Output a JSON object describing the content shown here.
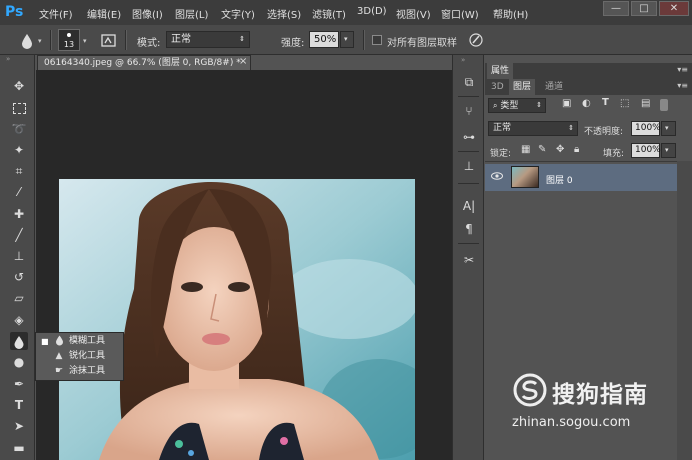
{
  "app": {
    "logo": "Ps"
  },
  "menubar": {
    "items": [
      "文件(F)",
      "编辑(E)",
      "图像(I)",
      "图层(L)",
      "文字(Y)",
      "选择(S)",
      "滤镜(T)",
      "3D(D)",
      "视图(V)",
      "窗口(W)",
      "帮助(H)"
    ],
    "window_controls": [
      "—",
      "□",
      "✕"
    ]
  },
  "options_bar": {
    "brush_size": "13",
    "mode_label": "模式:",
    "mode_value": "正常",
    "strength_label": "强度:",
    "strength_value": "50%",
    "sample_all_label": "对所有图层取样"
  },
  "document": {
    "tab_title": "06164340.jpeg @ 66.7% (图层 0, RGB/8#) *",
    "close": "×"
  },
  "flyout": {
    "items": [
      {
        "label": "模糊工具",
        "icon": "blur-drop-icon",
        "selected": true
      },
      {
        "label": "锐化工具",
        "icon": "sharpen-triangle-icon",
        "selected": false
      },
      {
        "label": "涂抹工具",
        "icon": "smudge-finger-icon",
        "selected": false
      }
    ]
  },
  "panels": {
    "properties_title": "属性",
    "tabs": [
      "3D",
      "图层",
      "通道"
    ],
    "filter_kind": "类型",
    "blend_mode": "正常",
    "opacity_label": "不透明度:",
    "opacity_value": "100%",
    "lock_label": "锁定:",
    "fill_label": "填充:",
    "fill_value": "100%",
    "layer_name": "图层 0"
  },
  "watermark": {
    "title": "搜狗指南",
    "url": "zhinan.sogou.com"
  },
  "colors": {
    "ps_blue": "#31a8ff",
    "menubar_bg": "#3c3c3c",
    "panel_bg": "#535353",
    "selected_layer": "#5d6c80"
  }
}
